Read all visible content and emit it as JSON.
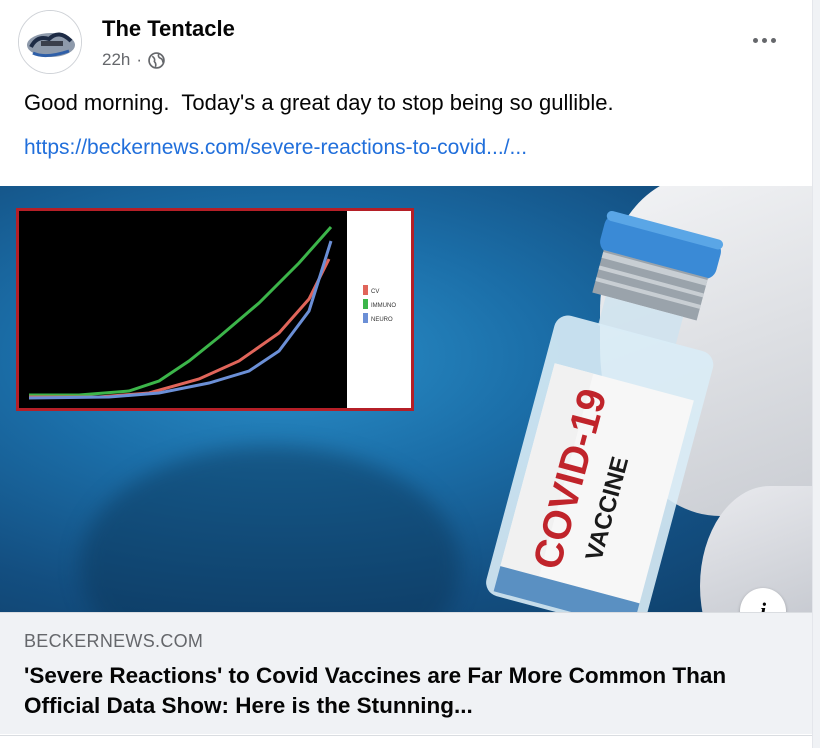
{
  "post": {
    "author": "The Tentacle",
    "time": "22h",
    "separator": "·",
    "privacy_icon": "globe-icon",
    "more_icon": "ellipsis-icon",
    "text": "Good morning.  Today's a great day to stop being so gullible.",
    "link": "https://beckernews.com/severe-reactions-to-covid.../..."
  },
  "image": {
    "vial_label_main": "COVID-19",
    "vial_label_sub": "VACCINE",
    "legend": [
      "CV",
      "IMMUNO",
      "NEURO"
    ],
    "info_icon": "info-icon",
    "info_glyph": "i"
  },
  "link_card": {
    "domain": "BECKERNEWS.COM",
    "headline": "'Severe Reactions' to Covid Vaccines are Far More Common Than Official Data Show: Here is the Stunning..."
  },
  "colors": {
    "link": "#216fdb",
    "secondary_text": "#65676b",
    "series_cv": "#e0655a",
    "series_immuno": "#3cb54a",
    "series_neuro": "#6b8fd6"
  }
}
